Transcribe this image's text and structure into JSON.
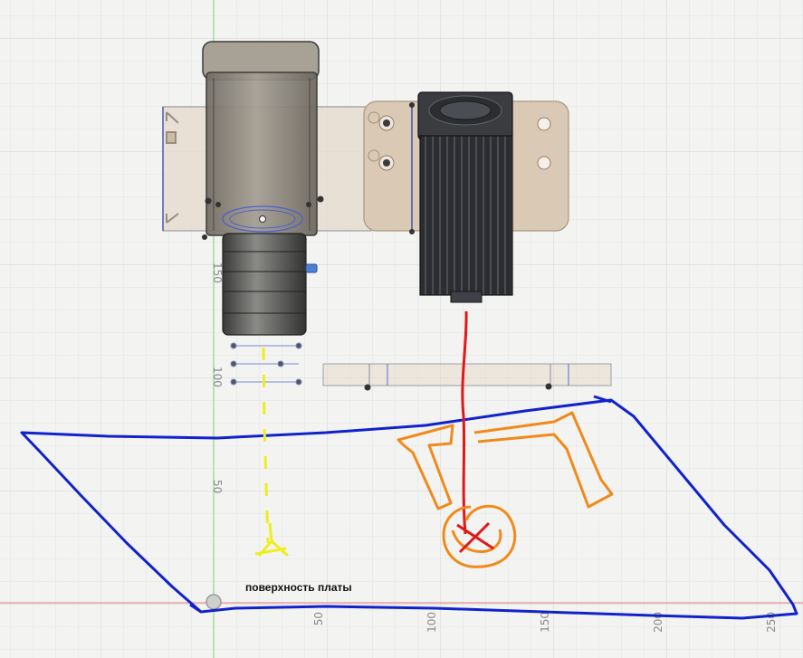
{
  "viewport": {
    "background": "#f3f3f2",
    "grid_minor_color": "#e2e4e6",
    "grid_major_color": "#d2d5d8"
  },
  "axes": {
    "x_axis_color": "#e07a7a",
    "y_axis_color": "#7fcf7f",
    "x_ticks": [
      "50",
      "100",
      "150",
      "200",
      "250"
    ],
    "y_ticks": [
      "150",
      "100",
      "50"
    ]
  },
  "annotation": {
    "board_surface_label": "поверхность платы",
    "outline_color": "#1122cc",
    "beam_color": "#e01818",
    "target_color": "#f08a1a",
    "sight_line_color": "#eeee22"
  },
  "model": {
    "mount_plate_color": "#e6dacb",
    "housing_color": "#8f8a80",
    "lens_color": "#5a5a58",
    "laser_body_color": "#2b2d31",
    "fan_color": "#3a3c40"
  }
}
